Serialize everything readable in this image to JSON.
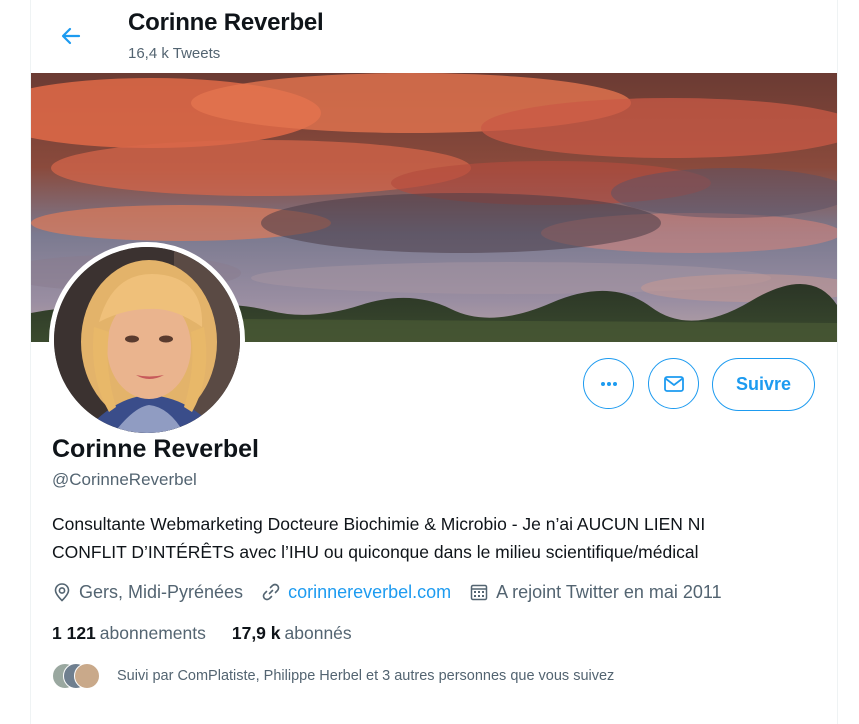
{
  "header": {
    "title": "Corinne Reverbel",
    "tweet_count": "16,4 k Tweets",
    "back_icon": "arrow-left-icon"
  },
  "profile": {
    "name": "Corinne Reverbel",
    "handle": "@CorinneReverbel",
    "bio_line1": "Consultante Webmarketing Docteure Biochimie & Microbio - Je n’ai AUCUN LIEN NI",
    "bio_line2": "CONFLIT D’INTÉRÊTS avec l’IHU ou quiconque dans le milieu scientifique/médical",
    "location": "Gers, Midi-Pyrénées",
    "website": "corinnereverbel.com",
    "joined": "A rejoint Twitter en mai 2011"
  },
  "actions": {
    "more_icon": "more-icon",
    "message_icon": "envelope-icon",
    "follow_label": "Suivre"
  },
  "stats": {
    "following_count": "1 121",
    "following_label": "abonnements",
    "followers_count": "17,9 k",
    "followers_label": "abonnés"
  },
  "followed_by": {
    "text": "Suivi par ComPlatiste, Philippe Herbel et 3 autres personnes que vous suivez"
  },
  "colors": {
    "accent": "#1d9bf0",
    "secondary_text": "#536471",
    "primary_text": "#0f1419"
  }
}
